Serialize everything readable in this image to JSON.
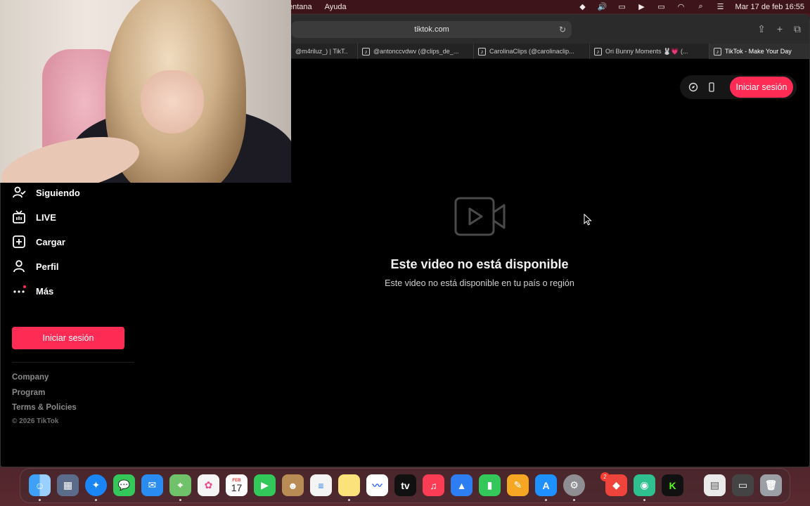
{
  "menubar": {
    "menus": [
      "entana",
      "Ayuda"
    ],
    "clock": "Mar 17 de feb  16:55",
    "status_icons": [
      "dropbox-icon",
      "volume-icon",
      "screen-mirror-icon",
      "play-icon",
      "battery-icon",
      "wifi-icon",
      "search-icon",
      "control-center-icon"
    ]
  },
  "browser": {
    "url": "tiktok.com",
    "tabs": [
      {
        "label": "@m4riluz_) | TikT...",
        "active": false
      },
      {
        "label": "@antonccvdwv (@clips_de_...",
        "active": false
      },
      {
        "label": "CarolinaClips (@carolinaclip...",
        "active": false
      },
      {
        "label": "Ori Bunny Moments 🐰💗 (...",
        "active": false
      },
      {
        "label": "TikTok - Make Your Day",
        "active": true
      }
    ]
  },
  "header": {
    "login_label": "Iniciar sesión"
  },
  "sidebar": {
    "items": [
      {
        "label": "Siguiendo",
        "icon": "following-icon"
      },
      {
        "label": "LIVE",
        "icon": "live-tv-icon"
      },
      {
        "label": "Cargar",
        "icon": "upload-icon"
      },
      {
        "label": "Perfil",
        "icon": "profile-icon"
      },
      {
        "label": "Más",
        "icon": "more-icon"
      }
    ],
    "login_label": "Iniciar sesión",
    "footer_links": [
      "Company",
      "Program",
      "Terms & Policies"
    ],
    "copyright": "© 2026 TikTok"
  },
  "main": {
    "title": "Este video no está disponible",
    "subtitle": "Este video no está disponible en tu país o región"
  },
  "dock": {
    "calendar_month": "FEB",
    "calendar_day": "17",
    "settings_badge": "2",
    "apps": [
      "finder-icon",
      "launchpad-icon",
      "safari-icon",
      "messages-icon",
      "mail-icon",
      "maps-icon",
      "photos-icon",
      "calendar-icon",
      "facetime-icon",
      "contacts-icon",
      "reminders-icon",
      "notes-icon",
      "freeform-icon",
      "tv-icon",
      "music-icon",
      "keynote-icon",
      "numbers-icon",
      "pages-icon",
      "app-store-icon",
      "system-settings-icon",
      "anydesk-icon",
      "streamlabs-icon",
      "kick-icon",
      "preview-icon",
      "window-icon",
      "trash-icon"
    ]
  }
}
